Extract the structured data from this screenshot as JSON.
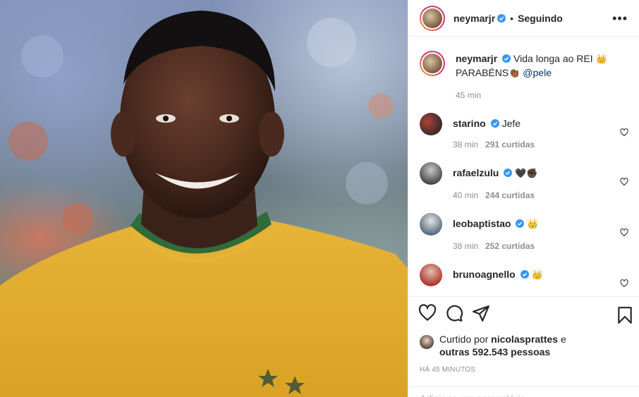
{
  "header": {
    "username": "neymarjr",
    "separator": "•",
    "follow_state": "Seguindo",
    "more_icon": "•••"
  },
  "caption": {
    "username": "neymarjr",
    "text": "Vida longa ao REI",
    "crown": "👑",
    "line2": "PARABÉNS",
    "clap": "👏🏾",
    "mention": "@pele",
    "time": "45 min"
  },
  "comments": [
    {
      "username": "starino",
      "text": "Jefe",
      "time": "38 min",
      "likes": "291 curtidas",
      "verified": true
    },
    {
      "username": "rafaelzulu",
      "text": "🖤✊🏿",
      "time": "40 min",
      "likes": "244 curtidas",
      "verified": true
    },
    {
      "username": "leobaptistao",
      "text": "👑",
      "time": "38 min",
      "likes": "252 curtidas",
      "verified": true
    },
    {
      "username": "brunoagnello",
      "text": "👑",
      "time": "",
      "likes": "",
      "verified": true
    }
  ],
  "likes": {
    "prefix": "Curtido por",
    "user": "nicolasprattes",
    "conj": "e",
    "others": "outras 592.543 pessoas"
  },
  "timestamp": "HÁ 45 MINUTOS",
  "add_comment_placeholder": "Adicione um comentário...",
  "colors": {
    "verified": "#3897f0",
    "meta": "#8e8e8e",
    "border": "#efefef"
  },
  "icons": [
    "heart-icon",
    "comment-icon",
    "share-icon",
    "bookmark-icon",
    "verified-icon",
    "more-options-icon"
  ]
}
